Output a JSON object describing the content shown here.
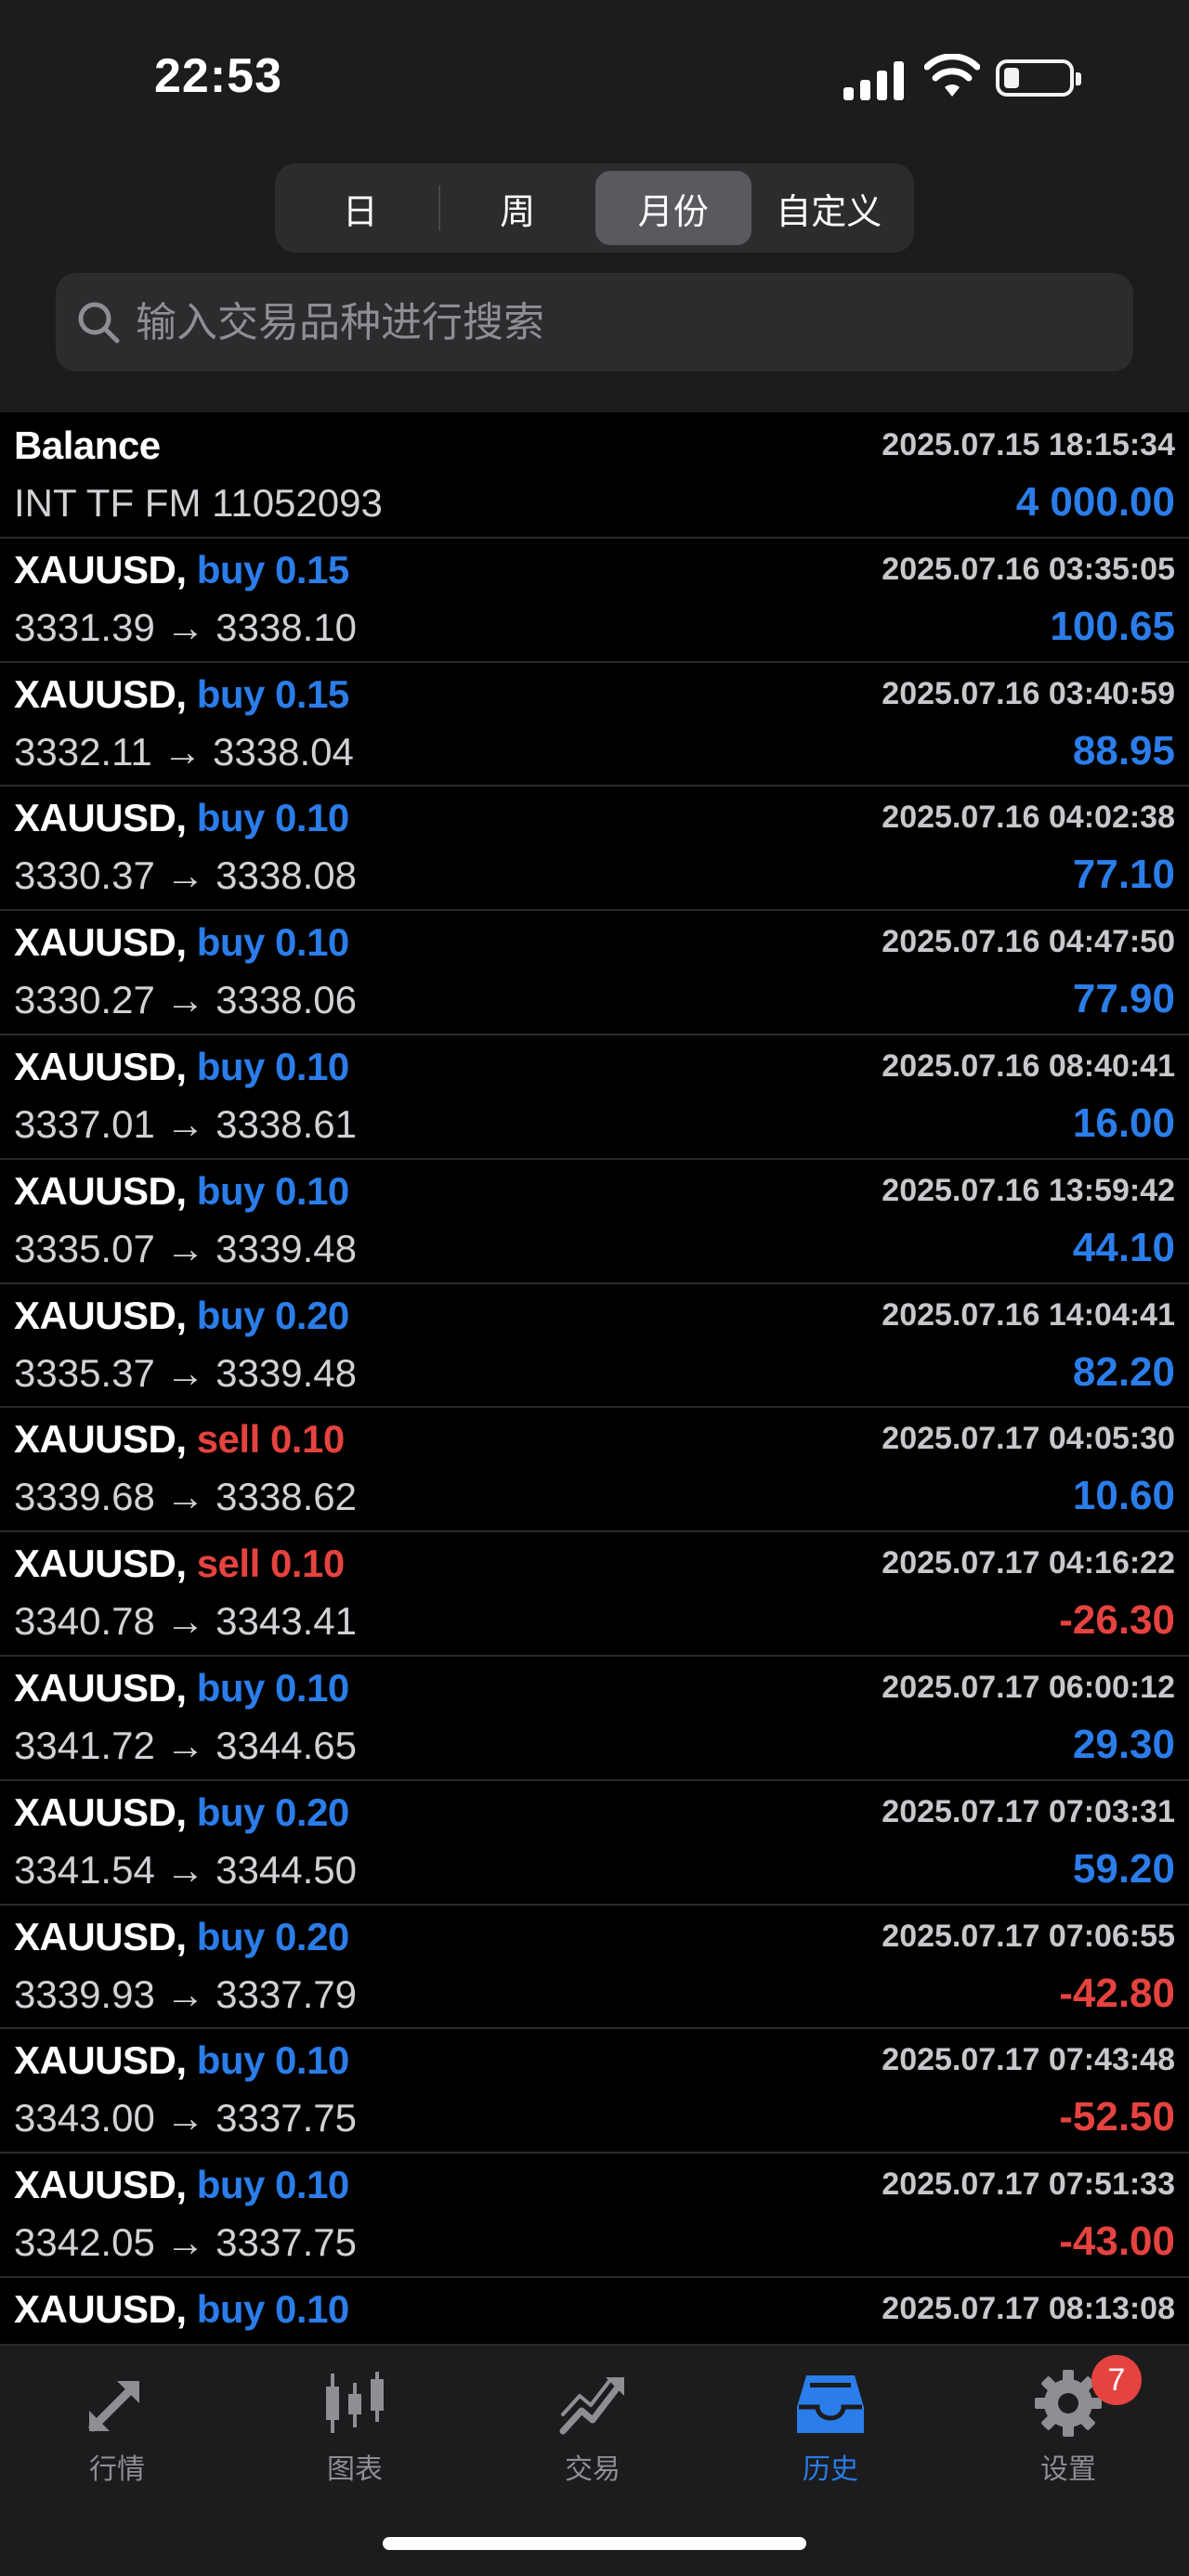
{
  "status_bar": {
    "time": "22:53"
  },
  "segments": [
    {
      "label": "日",
      "active": false
    },
    {
      "label": "周",
      "active": false
    },
    {
      "label": "月份",
      "active": true
    },
    {
      "label": "自定义",
      "active": false
    }
  ],
  "search": {
    "placeholder": "输入交易品种进行搜索"
  },
  "balance": {
    "title": "Balance",
    "time": "2025.07.15 18:15:34",
    "comment": "INT TF FM 11052093",
    "amount": "4 000.00"
  },
  "deals": [
    {
      "symbol": "XAUUSD,",
      "side": "buy",
      "lots": "0.15",
      "time": "2025.07.16 03:35:05",
      "open": "3331.39",
      "close": "3338.10",
      "profit": "100.65"
    },
    {
      "symbol": "XAUUSD,",
      "side": "buy",
      "lots": "0.15",
      "time": "2025.07.16 03:40:59",
      "open": "3332.11",
      "close": "3338.04",
      "profit": "88.95"
    },
    {
      "symbol": "XAUUSD,",
      "side": "buy",
      "lots": "0.10",
      "time": "2025.07.16 04:02:38",
      "open": "3330.37",
      "close": "3338.08",
      "profit": "77.10"
    },
    {
      "symbol": "XAUUSD,",
      "side": "buy",
      "lots": "0.10",
      "time": "2025.07.16 04:47:50",
      "open": "3330.27",
      "close": "3338.06",
      "profit": "77.90"
    },
    {
      "symbol": "XAUUSD,",
      "side": "buy",
      "lots": "0.10",
      "time": "2025.07.16 08:40:41",
      "open": "3337.01",
      "close": "3338.61",
      "profit": "16.00"
    },
    {
      "symbol": "XAUUSD,",
      "side": "buy",
      "lots": "0.10",
      "time": "2025.07.16 13:59:42",
      "open": "3335.07",
      "close": "3339.48",
      "profit": "44.10"
    },
    {
      "symbol": "XAUUSD,",
      "side": "buy",
      "lots": "0.20",
      "time": "2025.07.16 14:04:41",
      "open": "3335.37",
      "close": "3339.48",
      "profit": "82.20"
    },
    {
      "symbol": "XAUUSD,",
      "side": "sell",
      "lots": "0.10",
      "time": "2025.07.17 04:05:30",
      "open": "3339.68",
      "close": "3338.62",
      "profit": "10.60"
    },
    {
      "symbol": "XAUUSD,",
      "side": "sell",
      "lots": "0.10",
      "time": "2025.07.17 04:16:22",
      "open": "3340.78",
      "close": "3343.41",
      "profit": "-26.30"
    },
    {
      "symbol": "XAUUSD,",
      "side": "buy",
      "lots": "0.10",
      "time": "2025.07.17 06:00:12",
      "open": "3341.72",
      "close": "3344.65",
      "profit": "29.30"
    },
    {
      "symbol": "XAUUSD,",
      "side": "buy",
      "lots": "0.20",
      "time": "2025.07.17 07:03:31",
      "open": "3341.54",
      "close": "3344.50",
      "profit": "59.20"
    },
    {
      "symbol": "XAUUSD,",
      "side": "buy",
      "lots": "0.20",
      "time": "2025.07.17 07:06:55",
      "open": "3339.93",
      "close": "3337.79",
      "profit": "-42.80"
    },
    {
      "symbol": "XAUUSD,",
      "side": "buy",
      "lots": "0.10",
      "time": "2025.07.17 07:43:48",
      "open": "3343.00",
      "close": "3337.75",
      "profit": "-52.50"
    },
    {
      "symbol": "XAUUSD,",
      "side": "buy",
      "lots": "0.10",
      "time": "2025.07.17 07:51:33",
      "open": "3342.05",
      "close": "3337.75",
      "profit": "-43.00"
    },
    {
      "symbol": "XAUUSD,",
      "side": "buy",
      "lots": "0.10",
      "time": "2025.07.17 08:13:08",
      "open": "",
      "close": "",
      "profit": ""
    }
  ],
  "arrow": "→",
  "tabs": [
    {
      "label": "行情",
      "icon": "trend-arrows-icon",
      "active": false
    },
    {
      "label": "图表",
      "icon": "candlestick-icon",
      "active": false
    },
    {
      "label": "交易",
      "icon": "trade-chart-icon",
      "active": false
    },
    {
      "label": "历史",
      "icon": "inbox-tray-icon",
      "active": true
    },
    {
      "label": "设置",
      "icon": "gear-icon",
      "active": false
    }
  ],
  "settings_badge": "7",
  "colors": {
    "buy": "#2b7de9",
    "sell": "#e5433f",
    "profit_pos": "#2b7de9",
    "profit_neg": "#e5433f",
    "active_tab": "#2b7de9"
  }
}
